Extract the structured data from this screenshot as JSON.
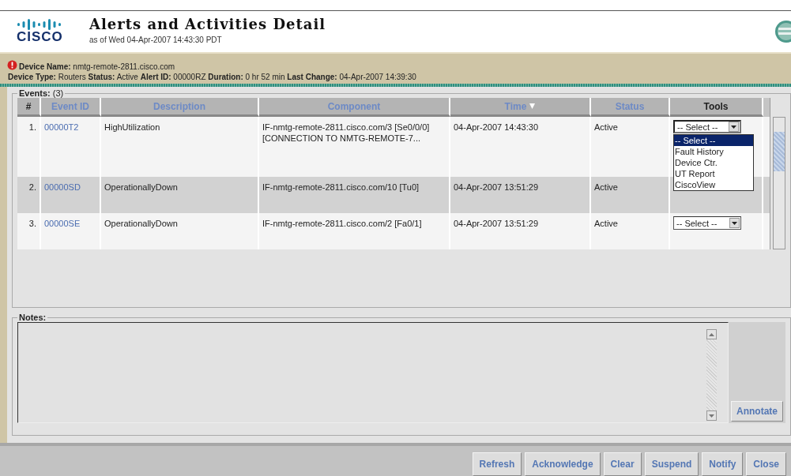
{
  "header": {
    "title": "Alerts and Activities Detail",
    "subtitle": "as of Wed 04-Apr-2007 14:43:30 PDT",
    "logo_text": "CISCO"
  },
  "alert": {
    "lines": [
      "**Device Name:** nmtg-remote-2811.cisco.com",
      "**Device Type:** Routers **Status:** Active **Alert ID:** 00000RZ **Duration:** 0 hr 52 min **Last Change:** 04-Apr-2007 14:39:30"
    ]
  },
  "events": {
    "legend": "**Events:** (3)",
    "columns": [
      {
        "label": "#",
        "sortable": false,
        "sorted": false
      },
      {
        "label": "Event ID",
        "sortable": true,
        "sorted": false
      },
      {
        "label": "Description",
        "sortable": true,
        "sorted": false
      },
      {
        "label": "Component",
        "sortable": true,
        "sorted": false
      },
      {
        "label": "Time",
        "sortable": true,
        "sorted": true
      },
      {
        "label": "Status",
        "sortable": true,
        "sorted": false
      },
      {
        "label": "Tools",
        "sortable": false,
        "sorted": false
      }
    ],
    "rows": [
      {
        "number": "1.",
        "event_id": "00000T2",
        "description": "HighUtilization",
        "component": "IF-nmtg-remote-2811.cisco.com/3 [Se0/0/0] [CONNECTION TO NMTG-REMOTE-7...",
        "time": "04-Apr-2007 14:43:30",
        "status": "Active",
        "tools": {
          "value": "-- Select --",
          "expanded": true,
          "options": [
            {
              "label": "-- Select --",
              "selected": true
            },
            {
              "label": "Fault History",
              "selected": false
            },
            {
              "label": "Device Ctr.",
              "selected": false
            },
            {
              "label": "UT Report",
              "selected": false
            },
            {
              "label": "CiscoView",
              "selected": false
            }
          ]
        }
      },
      {
        "number": "2.",
        "event_id": "00000SD",
        "description": "OperationallyDown",
        "component": "IF-nmtg-remote-2811.cisco.com/10 [Tu0]",
        "time": "04-Apr-2007 13:51:29",
        "status": "Active"
      },
      {
        "number": "3.",
        "event_id": "00000SE",
        "description": "OperationallyDown",
        "component": "IF-nmtg-remote-2811.cisco.com/2 [Fa0/1]",
        "time": "04-Apr-2007 13:51:29",
        "status": "Active",
        "tools": {
          "value": "-- Select --",
          "expanded": false
        }
      }
    ]
  },
  "notes": {
    "legend": "Notes:",
    "button": "Annotate"
  },
  "buttons": [
    "Refresh",
    "Acknowledge",
    "Clear",
    "Suspend",
    "Notify",
    "Close"
  ]
}
